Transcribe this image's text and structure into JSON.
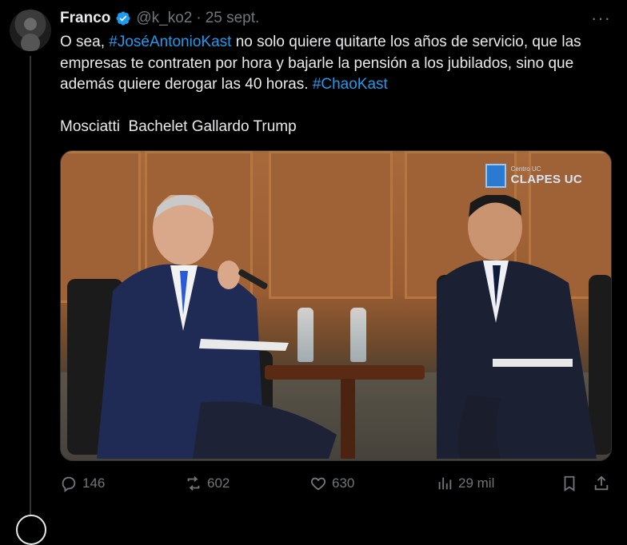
{
  "tweet": {
    "author_name": "Franco",
    "handle": "@k_ko2",
    "separator": "·",
    "date": "25 sept.",
    "more_label": "···",
    "text_parts": {
      "p1": "O sea, ",
      "hashtag1": "#JoséAntonioKast",
      "p2": " no solo quiere quitarte los años de servicio, que las empresas te contraten por hora y bajarle la pensión a los jubilados, sino que además quiere derogar las 40 horas. ",
      "hashtag2": "#ChaoKast"
    },
    "names_line": "Mosciatti  Bachelet Gallardo Trump",
    "media": {
      "watermark_small": "Centro UC",
      "watermark": "CLAPES UC"
    },
    "metrics": {
      "replies": "146",
      "reposts": "602",
      "likes": "630",
      "views": "29 mil"
    }
  },
  "colors": {
    "background": "#000000",
    "text": "#e7e9ea",
    "muted": "#71767b",
    "link": "#1d9bf0",
    "verified": "#1d9bf0"
  },
  "icons": [
    "verified-badge-icon",
    "more-icon",
    "reply-icon",
    "repost-icon",
    "like-icon",
    "views-icon",
    "bookmark-icon",
    "share-icon"
  ]
}
